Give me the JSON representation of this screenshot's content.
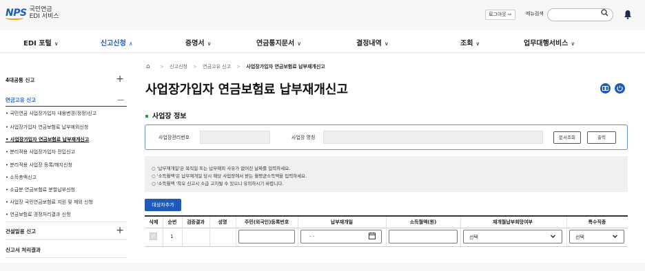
{
  "header": {
    "logo_mark": "NPS",
    "logo_line1": "국민연금",
    "logo_line2": "EDI 서비스",
    "logout_label": "로그아웃 ⇨",
    "menu_search_label": "메뉴검색",
    "search_placeholder": ""
  },
  "gnb": [
    {
      "label": "EDI 포털",
      "caret": "∨"
    },
    {
      "label": "신고신청",
      "caret": "∧"
    },
    {
      "label": "증명서",
      "caret": "∨"
    },
    {
      "label": "연금통지문서",
      "caret": "∨"
    },
    {
      "label": "결정내역",
      "caret": "∨"
    },
    {
      "label": "조회",
      "caret": "∨"
    },
    {
      "label": "업무대행서비스",
      "caret": "∨"
    }
  ],
  "lnb": {
    "groups": [
      {
        "label": "4대공통 신고",
        "toggle": "+"
      },
      {
        "label": "연금고유 신고",
        "toggle": "—"
      },
      {
        "label": "건설일용 신고",
        "toggle": "+"
      },
      {
        "label": "신고서 처리결과",
        "toggle": ""
      }
    ],
    "items": [
      "• 국민연금 사업장가입자 내용변경(정정)신고",
      "• 사업장가입자 연금보험료 납부예외신청",
      "• 사업장가입자 연금보험료 납부재개신고",
      "• 분리적용 사업장가입자 전입신고",
      "• 분리적용 사업장 등록/해지신청",
      "• 소득총액신고",
      "• 소급분 연금보험료 분할납부신청",
      "• 사업장 국민연금보험료 지원 및 제외 신청",
      "• 연금보험료 경정처리결과 신청"
    ]
  },
  "breadcrumb": {
    "items": [
      "신고신청",
      "연금고유 신고"
    ],
    "current": "사업장가입자 연금보험료 납부재개신고",
    "sep": ">"
  },
  "page": {
    "title": "사업장가입자 연금보험료 납부재개신고",
    "section_title": "사업장 정보"
  },
  "biz": {
    "mgmt_no_label": "사업장관리번호",
    "mgmt_no_value": "",
    "name_label": "사업장 명칭",
    "name_value": "",
    "doc_search_label": "문서조회",
    "print_label": "출력"
  },
  "notice": [
    "○ '납부재개일'은 복직일 또는 납부예외 사유가 없어진 날짜를 입력하세요.",
    "○ '소득월액'은 납부재개일 당시 해당 사업장에서 받는 월평균소득액을 입력하세요.",
    "○ '소득월액 '착오 신고시 소급 고지될 수 있으니 유의하시기 바랍니다."
  ],
  "add_button_label": "대상자추가",
  "table": {
    "headers": [
      "삭제",
      "순번",
      "검증결과",
      "성명",
      "주민(외국인)등록번호",
      "납부재개일",
      "소득월액(원)",
      "재개월납부희망여부",
      "특수직종"
    ],
    "row": {
      "seq": "1",
      "date_placeholder": "- -",
      "resume_select": "선택",
      "special_select": "선택"
    }
  }
}
